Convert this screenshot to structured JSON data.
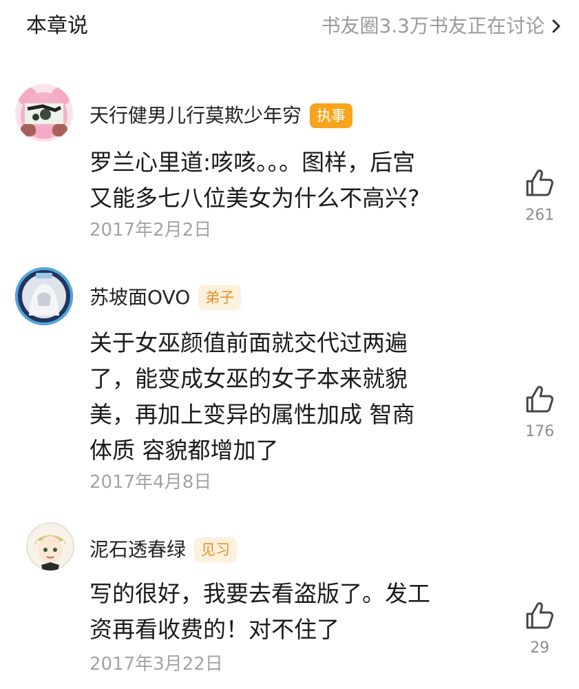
{
  "header": {
    "title": "本章说",
    "link_text": "书友圈3.3万书友正在讨论"
  },
  "colors": {
    "badge_orange": "#f7a51c",
    "badge_light_bg": "#fdf0dc",
    "badge_light_text": "#e0912a"
  },
  "comments": [
    {
      "username": "天行健男儿行莫欺少年穷",
      "badge": "执事",
      "lines": [
        "罗兰心里道:咳咳。。。图样，后宫",
        "又能多七八位美女为什么不高兴?"
      ],
      "date": "2017年2月2日",
      "likes": "261",
      "avatar_icon": "pink-bear-avatar"
    },
    {
      "username": "苏坡面OVO",
      "badge": "弟子",
      "lines": [
        "关于女巫颜值前面就交代过两遍",
        "了，能变成女巫的女子本来就貌",
        "美，再加上变异的属性加成 智商",
        "体质 容貌都增加了"
      ],
      "date": "2017年4月8日",
      "likes": "176",
      "avatar_icon": "white-hair-character-avatar"
    },
    {
      "username": "泥石透春绿",
      "badge": "见习",
      "lines": [
        "写的很好，我要去看盗版了。发工",
        "资再看收费的！对不住了"
      ],
      "date": "2017年3月22日",
      "likes": "29",
      "avatar_icon": "anime-boy-avatar"
    }
  ]
}
